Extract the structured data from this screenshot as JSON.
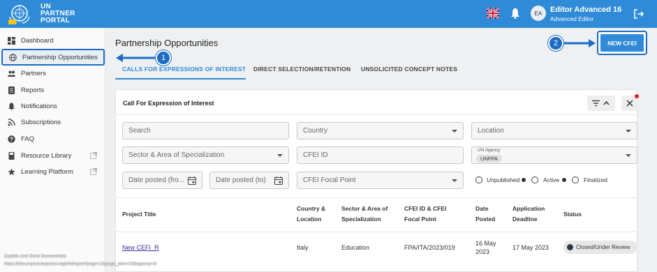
{
  "header": {
    "brand_line1": "UN",
    "brand_line2": "PARTNER",
    "brand_line3": "PORTAL",
    "user_initials": "EA",
    "user_name": "Editor Advanced 16",
    "user_role": "Advanced Editor"
  },
  "sidebar": {
    "items": [
      {
        "label": "Dashboard",
        "icon": "dashboard-icon"
      },
      {
        "label": "Partnership Opportunities",
        "icon": "globe-icon"
      },
      {
        "label": "Partners",
        "icon": "people-icon"
      },
      {
        "label": "Reports",
        "icon": "report-icon"
      },
      {
        "label": "Notifications",
        "icon": "bell-icon"
      },
      {
        "label": "Subscriptions",
        "icon": "rss-icon"
      },
      {
        "label": "FAQ",
        "icon": "help-icon"
      },
      {
        "label": "Resource Library",
        "icon": "book-icon"
      },
      {
        "label": "Learning Platform",
        "icon": "star-icon"
      }
    ]
  },
  "page": {
    "title": "Partnership Opportunities",
    "new_button": "NEW CFEI",
    "tabs": [
      "CALLS FOR EXPRESSIONS OF INTEREST",
      "DIRECT SELECTION/RETENTION",
      "UNSOLICITED CONCEPT NOTES"
    ]
  },
  "annotations": {
    "badge1": "1",
    "badge2": "2"
  },
  "panel": {
    "title": "Call For Expression of Interest",
    "filters": {
      "search": "Search",
      "country": "Country",
      "location": "Location",
      "sector": "Sector & Area of Specialization",
      "cfei_id": "CFEI ID",
      "un_agency_label": "UN Agency",
      "un_agency_value": "UNFPA",
      "date_from": "Date posted (fro...",
      "date_to": "Date posted (to)",
      "focal_point": "CFEI Focal Point",
      "radio_unpublished": "Unpublished",
      "radio_active": "Active",
      "radio_finalized": "Finalized"
    },
    "table": {
      "headers": {
        "project_title": "Project Title",
        "country_l1": "Country &",
        "country_l2": "Location",
        "sector_l1": "Sector & Area of",
        "sector_l2": "Specialization",
        "cfei_l1": "CFEI ID & CFEI",
        "cfei_l2": "Focal Point",
        "date_l1": "Date",
        "date_l2": "Posted",
        "deadline_l1": "Application",
        "deadline_l2": "Deadline",
        "status": "Status"
      },
      "row": {
        "title": "New CEFI_R",
        "country": "Italy",
        "sector": "Education",
        "cfei_id": "FPA/ITA/2023/019",
        "date_l1": "16 May",
        "date_l2": "2023",
        "deadline": "17 May 2023",
        "status": "Closed/Under Review"
      }
    }
  },
  "footer": {
    "line1": "Explain and Send Screenshots",
    "line2": "https://dev.unpartnerportal.org/cfei/open?page=1&page_size=10&agency=5"
  }
}
